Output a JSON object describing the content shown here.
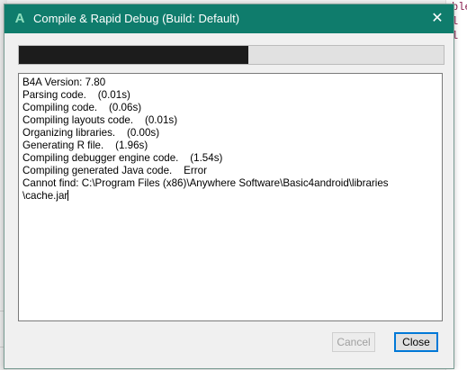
{
  "window": {
    "title": "Compile & Rapid Debug (Build: Default)",
    "icon_glyph": "A",
    "close_glyph": "✕",
    "title_color": "#0f7c6c"
  },
  "progress": {
    "fraction": 0.54
  },
  "log": {
    "lines": [
      "B4A Version: 7.80",
      "Parsing code.    (0.01s)",
      "Compiling code.    (0.06s)",
      "Compiling layouts code.    (0.01s)",
      "Organizing libraries.    (0.00s)",
      "Generating R file.    (1.96s)",
      "Compiling debugger engine code.    (1.54s)",
      "Compiling generated Java code.    Error",
      "Cannot find: C:\\Program Files (x86)\\Anywhere Software\\Basic4android\\libraries",
      "\\cache.jar"
    ]
  },
  "buttons": {
    "cancel_label": "Cancel",
    "close_label": "Close"
  },
  "background_editor": {
    "lines": [
      "ble  b",
      "l  'b",
      "l  'fo"
    ]
  }
}
